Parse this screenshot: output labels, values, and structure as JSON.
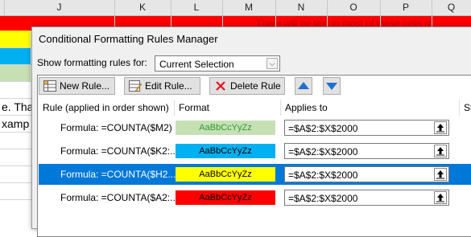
{
  "spreadsheet": {
    "columns": [
      "J",
      "K",
      "L",
      "M",
      "N",
      "O",
      "P",
      "Q"
    ],
    "red_note": "There will be text in most of these cells of",
    "cell_texts": [
      "e. Tha",
      "xamp"
    ]
  },
  "dialog": {
    "title": "Conditional Formatting Rules Manager",
    "show_rules_label": "Show formatting rules for:",
    "show_rules_value": "Current Selection",
    "toolbar": {
      "new_rule": "New Rule...",
      "edit_rule": "Edit Rule...",
      "delete_rule": "Delete Rule"
    },
    "columns": {
      "rule": "Rule (applied in order shown)",
      "format": "Format",
      "applies_to": "Applies to",
      "stop": "St"
    },
    "rules": [
      {
        "formula": "Formula: =COUNTA($M2)",
        "preview": "AaBbCcYyZz",
        "fill": "#c6e0b4",
        "text_color": "#2e9a3a",
        "applies_to": "=$A$2:$X$2000",
        "selected": false
      },
      {
        "formula": "Formula: =COUNTA($K2:...",
        "preview": "AaBbCcYyZz",
        "fill": "#00b0f0",
        "text_color": "#000000",
        "applies_to": "=$A$2:$X$2000",
        "selected": false
      },
      {
        "formula": "Formula: =COUNTA($H2...",
        "preview": "AaBbCcYyZz",
        "fill": "#ffff00",
        "text_color": "#000000",
        "applies_to": "=$A$2:$X$2000",
        "selected": true
      },
      {
        "formula": "Formula: =COUNTA($A2:...",
        "preview": "AaBbCcYyZz",
        "fill": "#ff0000",
        "text_color": "#000000",
        "applies_to": "=$A$2:$X$2000",
        "selected": false
      }
    ]
  },
  "colors": {
    "selection": "#0078d7",
    "arrow_blue": "#1f6fd0",
    "delete_red": "#e81123"
  },
  "icons": [
    "new-rule-icon",
    "edit-rule-icon",
    "delete-rule-icon",
    "move-up-icon",
    "move-down-icon",
    "range-picker-icon",
    "dropdown-arrow-icon"
  ]
}
